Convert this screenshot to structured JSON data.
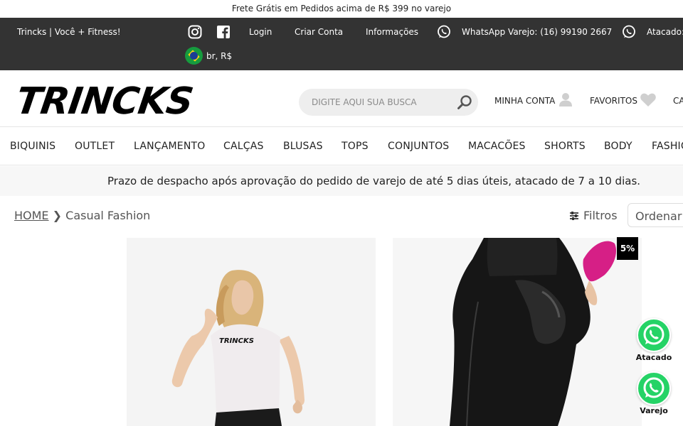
{
  "announcement": "Frete Grátis em Pedidos acima de R$ 399 no varejo",
  "topbar": {
    "tagline": "Trincks | Você + Fitness!",
    "login": "Login",
    "create_account": "Criar Conta",
    "info": "Informações",
    "whatsapp_retail": "WhatsApp Varejo: (16) 99190 2667",
    "whatsapp_wholesale": "Atacado:",
    "locale": "br, R$",
    "social_icons": [
      "instagram-icon",
      "facebook-icon"
    ]
  },
  "header": {
    "logo": "TRINCKS",
    "search_placeholder": "DIGITE AQUI SUA BUSCA",
    "my_account": "MINHA CONTA",
    "favorites": "FAVORITOS",
    "cart": "CA"
  },
  "nav": [
    "BIQUINIS",
    "OUTLET",
    "LANÇAMENTO",
    "CALÇAS",
    "BLUSAS",
    "TOPS",
    "CONJUNTOS",
    "MACACÕES",
    "SHORTS",
    "BODY",
    "FASHIO"
  ],
  "notice": "Prazo de despacho após aprovação do pedido de varejo de até 5 dias úteis, atacado de 7 a 10 dias.",
  "breadcrumb": {
    "home": "HOME",
    "separator": "❯",
    "current": "Casual Fashion"
  },
  "toolbar": {
    "filters": "Filtros",
    "order": "Ordenar"
  },
  "products": [
    {
      "image": "woman in white TRINCKS t-shirt",
      "shirt_text": "TRINCKS"
    },
    {
      "image": "black shiny leggings",
      "badge": "5%"
    }
  ],
  "whatsapp_float": {
    "wholesale": "Atacado",
    "retail": "Varejo"
  },
  "colors": {
    "topbar": "#333333",
    "whatsapp": "#25d366",
    "badge": "#000000"
  }
}
